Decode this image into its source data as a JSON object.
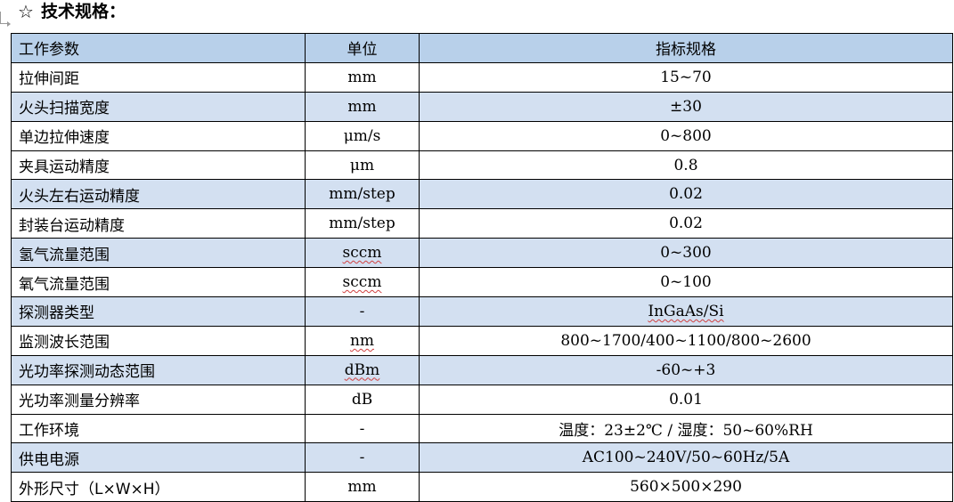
{
  "heading": {
    "star": "☆",
    "title": "技术规格："
  },
  "table": {
    "headers": [
      "工作参数",
      "单位",
      "指标规格"
    ],
    "rows": [
      {
        "param": "拉伸间距",
        "unit": "mm",
        "spec": "15~70",
        "shaded": false
      },
      {
        "param": "火头扫描宽度",
        "unit": "mm",
        "spec": "±30",
        "shaded": true
      },
      {
        "param": "单边拉伸速度",
        "unit": "μm/s",
        "spec": "0~800",
        "shaded": false
      },
      {
        "param": "夹具运动精度",
        "unit": "μm",
        "spec": "0.8",
        "shaded": false
      },
      {
        "param": "火头左右运动精度",
        "unit": "mm/step",
        "spec": "0.02",
        "shaded": true
      },
      {
        "param": "封装台运动精度",
        "unit": "mm/step",
        "spec": "0.02",
        "shaded": false
      },
      {
        "param": "氢气流量范围",
        "unit": "sccm",
        "spec": "0~300",
        "shaded": true
      },
      {
        "param": "氧气流量范围",
        "unit": "sccm",
        "spec": "0~100",
        "shaded": false
      },
      {
        "param": "探测器类型",
        "unit": "-",
        "spec": "InGaAs/Si",
        "shaded": true
      },
      {
        "param": "监测波长范围",
        "unit": "nm",
        "spec": "800~1700/400~1100/800~2600",
        "shaded": false
      },
      {
        "param": "光功率探测动态范围",
        "unit": "dBm",
        "spec": "-60~+3",
        "shaded": true
      },
      {
        "param": "光功率测量分辨率",
        "unit": "dB",
        "spec": "0.01",
        "shaded": false
      },
      {
        "param": "工作环境",
        "unit": "-",
        "spec": "温度：23±2℃ / 湿度：50~60%RH",
        "shaded": false
      },
      {
        "param": "供电电源",
        "unit": "-",
        "spec": "AC100~240V/50~60Hz/5A",
        "shaded": true
      },
      {
        "param": "外形尺寸（L×W×H）",
        "unit": "mm",
        "spec": "560×500×290",
        "shaded": false
      }
    ]
  },
  "spellcheck_flagged": [
    "sccm",
    "nm",
    "dBm",
    "InGaAs/Si"
  ]
}
